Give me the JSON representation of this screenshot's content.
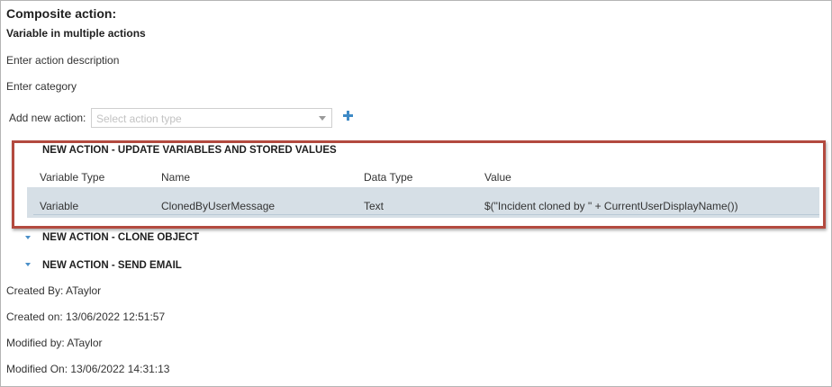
{
  "header": {
    "title": "Composite action:",
    "name": "Variable in multiple actions",
    "description_placeholder": "Enter action description",
    "category_placeholder": "Enter category"
  },
  "add_action": {
    "label": "Add new action:",
    "select_placeholder": "Select action type",
    "add_icon": "plus-icon"
  },
  "actions": [
    {
      "title": "NEW ACTION - UPDATE VARIABLES AND STORED VALUES",
      "highlighted": true,
      "highlight_color": "#b34a3f",
      "columns": [
        "Variable Type",
        "Name",
        "Data Type",
        "Value"
      ],
      "rows": [
        [
          "Variable",
          "ClonedByUserMessage",
          "Text",
          "$(\"Incident cloned by \" + CurrentUserDisplayName())"
        ]
      ]
    },
    {
      "title": "NEW ACTION - CLONE OBJECT",
      "collapsed_icon": "caret-down-icon"
    },
    {
      "title": "NEW ACTION - SEND EMAIL",
      "collapsed_icon": "caret-down-icon"
    }
  ],
  "meta": {
    "created_by": "Created By: ATaylor",
    "created_on": "Created on: 13/06/2022 12:51:57",
    "modified_by": "Modified by: ATaylor",
    "modified_on": "Modified On: 13/06/2022 14:31:13"
  },
  "colors": {
    "accent": "#3e8ac6",
    "row_highlight": "#d6dfe6",
    "border": "#b5b5b5"
  }
}
